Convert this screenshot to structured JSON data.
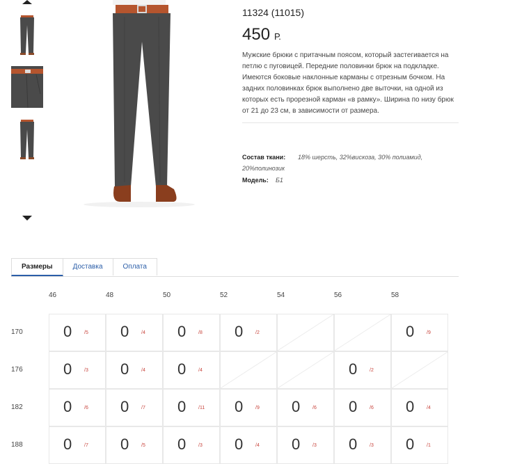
{
  "product": {
    "sku": "11324 (11015)",
    "price_value": "450",
    "price_currency": "Р.",
    "description": "Мужские брюки с притачным поясом, который застегивается на петлю с пуговицей. Передние половинки брюк на подкладке. Имеются боковые наклонные карманы с отрезным бочком. На задних половинках брюк выполнено две выточки, на одной из которых есть прорезной карман «в рамку». Ширина по низу брюк от 21 до 23 см, в зависимости от размера.",
    "composition_label": "Состав ткани:",
    "composition_value": "18% шерсть, 32%вискоза, 30% полиамид, 20%полинозик",
    "model_label": "Модель:",
    "model_value": "Б1"
  },
  "tabs": [
    {
      "label": "Размеры",
      "active": true
    },
    {
      "label": "Доставка",
      "active": false
    },
    {
      "label": "Оплата",
      "active": false
    }
  ],
  "sizes": {
    "columns": [
      "46",
      "48",
      "50",
      "52",
      "54",
      "56",
      "58"
    ],
    "rows": [
      {
        "height": "170",
        "cells": [
          {
            "q": "0",
            "s": "/5"
          },
          {
            "q": "0",
            "s": "/4"
          },
          {
            "q": "0",
            "s": "/8"
          },
          {
            "q": "0",
            "s": "/2"
          },
          null,
          null,
          {
            "q": "0",
            "s": "/9"
          }
        ]
      },
      {
        "height": "176",
        "cells": [
          {
            "q": "0",
            "s": "/3"
          },
          {
            "q": "0",
            "s": "/4"
          },
          {
            "q": "0",
            "s": "/4"
          },
          null,
          null,
          {
            "q": "0",
            "s": "/2"
          },
          null
        ]
      },
      {
        "height": "182",
        "cells": [
          {
            "q": "0",
            "s": "/6"
          },
          {
            "q": "0",
            "s": "/7"
          },
          {
            "q": "0",
            "s": "/11"
          },
          {
            "q": "0",
            "s": "/9"
          },
          {
            "q": "0",
            "s": "/6"
          },
          {
            "q": "0",
            "s": "/6"
          },
          {
            "q": "0",
            "s": "/4"
          }
        ]
      },
      {
        "height": "188",
        "cells": [
          {
            "q": "0",
            "s": "/7"
          },
          {
            "q": "0",
            "s": "/5"
          },
          {
            "q": "0",
            "s": "/3"
          },
          {
            "q": "0",
            "s": "/4"
          },
          {
            "q": "0",
            "s": "/3"
          },
          {
            "q": "0",
            "s": "/3"
          },
          {
            "q": "0",
            "s": "/1"
          }
        ]
      }
    ]
  },
  "icons": {
    "up": "arrow-up-icon",
    "down": "arrow-down-icon"
  },
  "colors": {
    "link": "#2b5ea8",
    "stock_red": "#c8443c",
    "trousers": "#4a4a4a",
    "belt": "#b5552e"
  }
}
